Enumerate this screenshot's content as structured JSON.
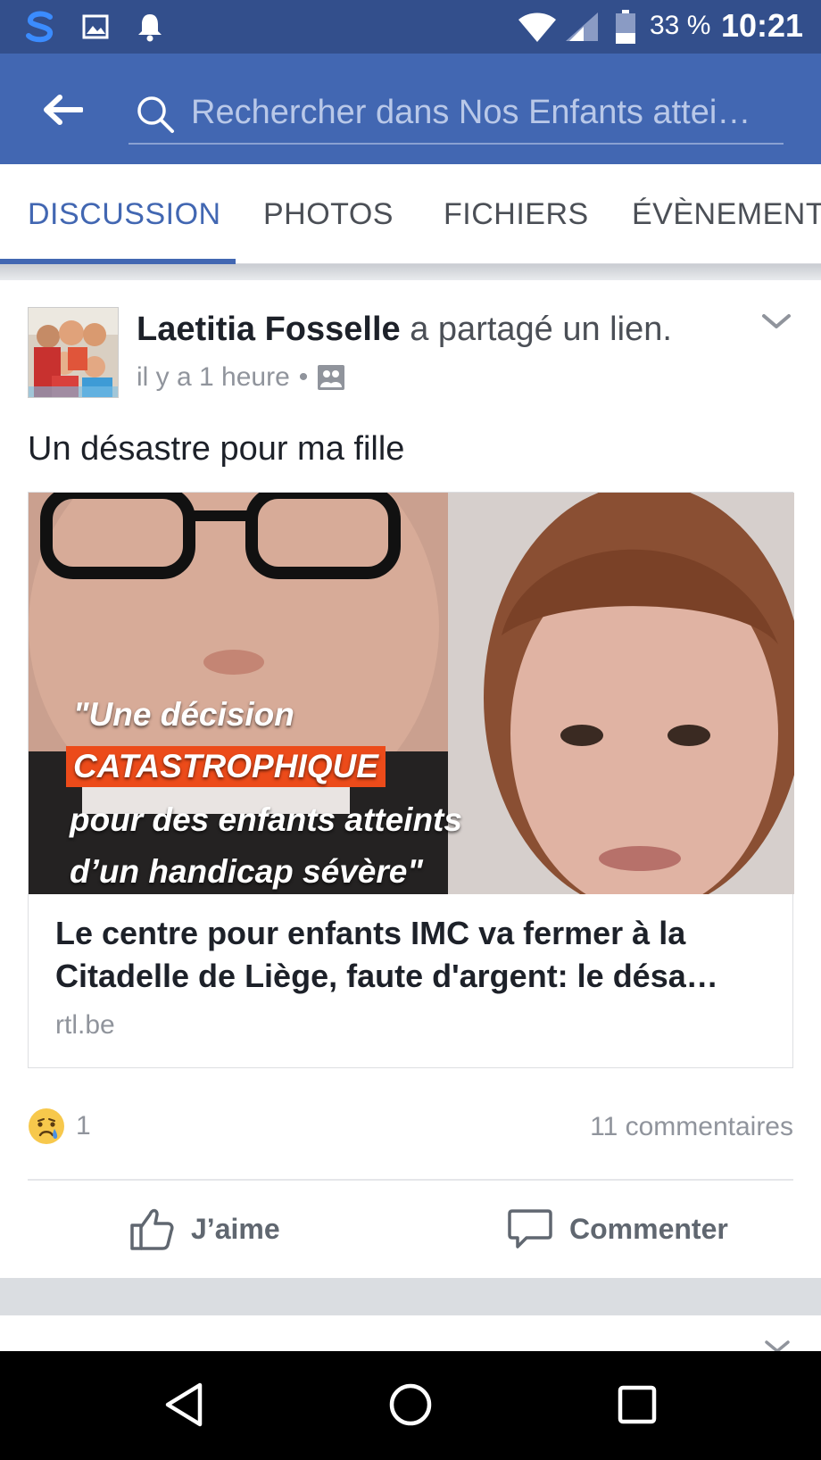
{
  "status_bar": {
    "battery_percent": "33 %",
    "time": "10:21",
    "icons": [
      "s-app-icon",
      "image-icon",
      "bell-icon",
      "wifi-icon",
      "signal-icon",
      "battery-icon"
    ]
  },
  "header": {
    "search_placeholder": "Rechercher dans Nos Enfants attei…",
    "back_icon": "back-arrow-icon",
    "search_icon": "search-icon"
  },
  "tabs": [
    {
      "label": "DISCUSSION",
      "active": true
    },
    {
      "label": "PHOTOS",
      "active": false
    },
    {
      "label": "FICHIERS",
      "active": false
    },
    {
      "label": "ÉVÈNEMENTS",
      "active": false
    }
  ],
  "post": {
    "author": "Laetitia Fosselle",
    "action": " a partagé un lien.",
    "timestamp": "il y a 1 heure",
    "separator": "•",
    "text": "Un désastre pour ma fille",
    "link": {
      "overlay_line1": "\"Une décision",
      "overlay_highlight": "CATASTROPHIQUE",
      "overlay_line3": "pour des enfants atteints",
      "overlay_line4": "d’un handicap sévère\"",
      "title": "Le centre pour enfants IMC va fermer à la Citadelle de Liège, faute d'argent: le désa…",
      "domain": "rtl.be"
    },
    "reaction_count": "1",
    "comments": "11 commentaires",
    "like_label": "J’aime",
    "comment_label": "Commenter"
  },
  "colors": {
    "facebook_blue": "#4267b2",
    "status_bar": "#334f8c",
    "highlight_orange": "#ec4b1a",
    "meta_gray": "#90949c"
  }
}
